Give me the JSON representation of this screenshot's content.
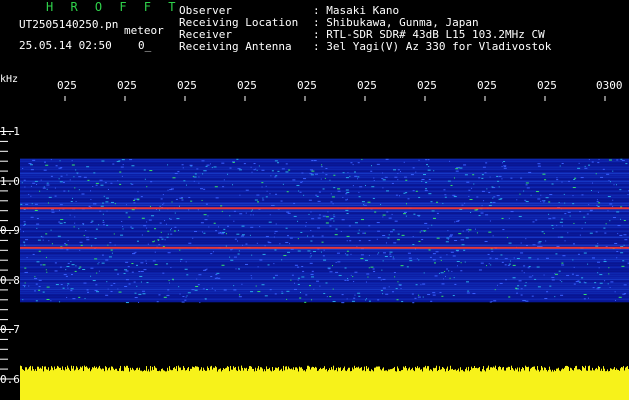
{
  "header": {
    "title": "H R O F F T",
    "filename": "UT2505140250.pn",
    "detector_label": "meteor",
    "datetime": "25.05.14 02:50",
    "status": "0_",
    "fields": [
      {
        "label": "Observer",
        "value": ": Masaki Kano"
      },
      {
        "label": "Receiving Location",
        "value": ": Shibukawa, Gunma, Japan"
      },
      {
        "label": "Receiver",
        "value": ": RTL-SDR SDR# 43dB L15 103.2MHz CW"
      },
      {
        "label": "Receiving Antenna",
        "value": ": 3el Yagi(V) Az 330 for Vladivostok"
      }
    ]
  },
  "axes": {
    "y_unit": "kHz",
    "x_ticks": [
      "025",
      "025",
      "025",
      "025",
      "025",
      "025",
      "025",
      "025",
      "025",
      "0300"
    ],
    "y_ticks": [
      "1.1",
      "1.0",
      "0.9",
      "0.8",
      "0.7",
      "0.6"
    ]
  },
  "colors": {
    "background": "#000000",
    "text": "#ffffff",
    "title": "#2fd14a",
    "band_base": "#0a1aa0",
    "echo_green": "#36e36a",
    "carrier_red": "#ff3b2f",
    "level_yellow": "#f7f21a",
    "tick_marks": "#ffffff"
  },
  "spectrogram": {
    "freq_range_khz": [
      0.6,
      1.12
    ],
    "band_khz": [
      0.755,
      1.045
    ],
    "carrier_lines_khz": [
      0.945,
      0.865
    ],
    "level_bar_khz": [
      0.6,
      0.615
    ]
  }
}
